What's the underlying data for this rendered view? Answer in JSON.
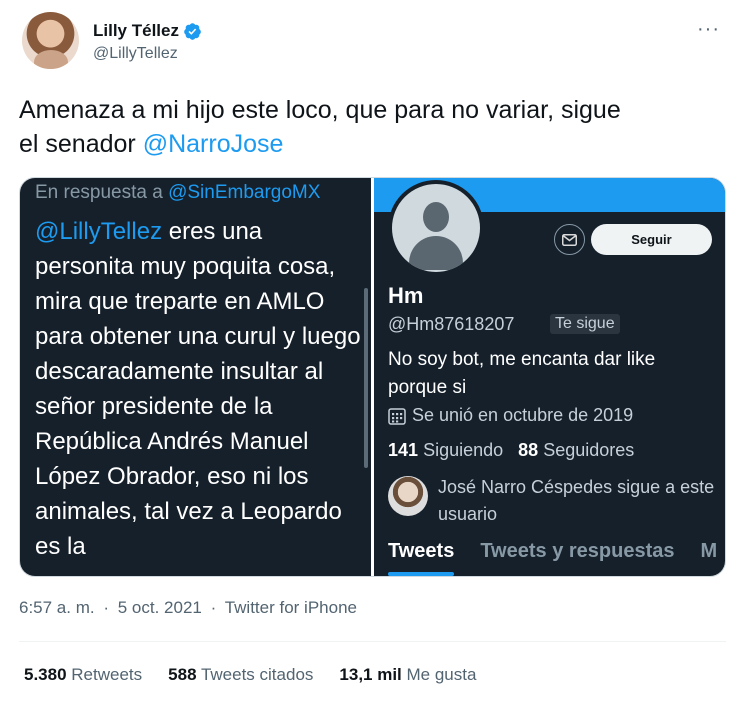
{
  "author": {
    "name": "Lilly Téllez",
    "handle": "@LillyTellez"
  },
  "tweet": {
    "text_line1": "Amenaza a mi hijo este loco, que para no variar, sigue",
    "text_line2_prefix": "el senador ",
    "text_mention": "@NarroJose"
  },
  "media_left": {
    "reply_prefix": "En respuesta a ",
    "reply_mention": "@SinEmbargoMX",
    "body_mention": "@LillyTellez",
    "body_text": " eres una personita muy poquita cosa, mira que treparte en AMLO para obtener una curul y luego descaradamente insultar al señor presidente de la República Andrés Manuel López Obrador, eso ni los animales, tal vez  a Leopardo es la"
  },
  "media_right": {
    "follow_label": "Seguir",
    "name": "Hm",
    "handle": "@Hm87618207",
    "follows_you": "Te sigue",
    "bio": "No soy bot, me encanta dar like porque si",
    "joined": "Se unió en octubre de 2019",
    "following_count": "141",
    "following_label": "Siguiendo",
    "followers_count": "88",
    "followers_label": "Seguidores",
    "mutual_text": "José Narro Céspedes sigue a este usuario",
    "tabs": [
      "Tweets",
      "Tweets y respuestas",
      "M"
    ]
  },
  "meta": {
    "time": "6:57 a. m.",
    "separator": "·",
    "date": "5 oct. 2021",
    "source": "Twitter for iPhone"
  },
  "stats": {
    "retweets_count": "5.380",
    "retweets_label": "Retweets",
    "quotes_count": "588",
    "quotes_label": "Tweets citados",
    "likes_count": "13,1 mil",
    "likes_label": "Me gusta"
  },
  "colors": {
    "accent": "#1d9bf0",
    "dark_bg": "#15202b"
  }
}
